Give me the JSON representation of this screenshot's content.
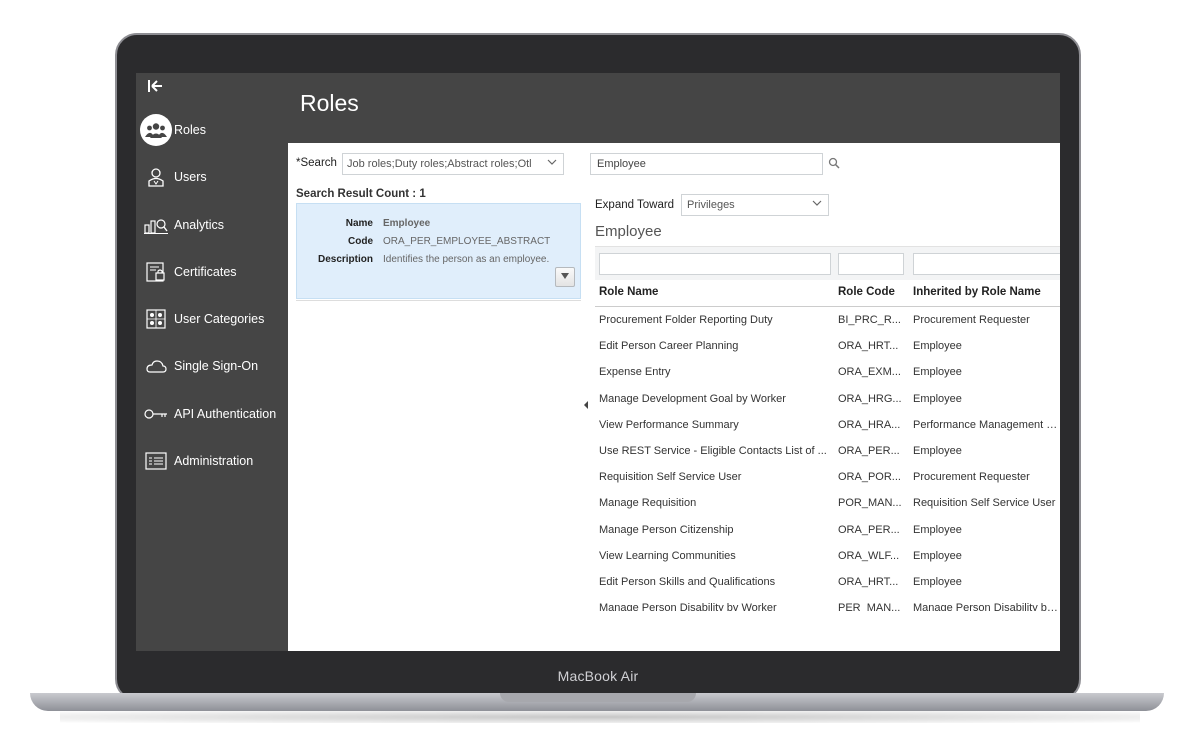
{
  "device": {
    "brand": "MacBook Air"
  },
  "sidebar": {
    "collapse_icon": "collapse-left-icon",
    "items": [
      {
        "label": "Roles",
        "icon": "roles-icon",
        "active": true
      },
      {
        "label": "Users",
        "icon": "user-icon"
      },
      {
        "label": "Analytics",
        "icon": "analytics-icon"
      },
      {
        "label": "Certificates",
        "icon": "certificate-icon"
      },
      {
        "label": "User Categories",
        "icon": "user-categories-icon"
      },
      {
        "label": "Single Sign-On",
        "icon": "cloud-icon"
      },
      {
        "label": "API Authentication",
        "icon": "key-icon"
      },
      {
        "label": "Administration",
        "icon": "list-icon"
      }
    ]
  },
  "header": {
    "title": "Roles"
  },
  "search": {
    "label": "Search",
    "required_mark": "*",
    "role_types_value": "Job roles;Duty roles;Abstract roles;Otl",
    "result_count_label": "Search Result Count : 1",
    "query_value": "Employee"
  },
  "result_card": {
    "name_label": "Name",
    "name_value": "Employee",
    "code_label": "Code",
    "code_value": "ORA_PER_EMPLOYEE_ABSTRACT",
    "description_label": "Description",
    "description_value": "Identifies the person as an employee."
  },
  "expand": {
    "label": "Expand Toward",
    "value": "Privileges"
  },
  "graph": {
    "title": "Employee"
  },
  "table": {
    "headers": {
      "role_name": "Role Name",
      "role_code": "Role Code",
      "inherited": "Inherited by Role Name"
    },
    "rows": [
      {
        "name": "Procurement Folder Reporting Duty",
        "code": "BI_PRC_R...",
        "inherited": "Procurement Requester"
      },
      {
        "name": "Edit Person Career Planning",
        "code": "ORA_HRT...",
        "inherited": "Employee"
      },
      {
        "name": "Expense Entry",
        "code": "ORA_EXM...",
        "inherited": "Employee"
      },
      {
        "name": "Manage Development Goal by Worker",
        "code": "ORA_HRG...",
        "inherited": "Employee"
      },
      {
        "name": "View Performance Summary",
        "code": "ORA_HRA...",
        "inherited": "Performance Management W..."
      },
      {
        "name": "Use REST Service - Eligible Contacts List of ...",
        "code": "ORA_PER...",
        "inherited": "Employee"
      },
      {
        "name": "Requisition Self Service User",
        "code": "ORA_POR...",
        "inherited": "Procurement Requester"
      },
      {
        "name": "Manage Requisition",
        "code": "POR_MAN...",
        "inherited": "Requisition Self Service User"
      },
      {
        "name": "Manage Person Citizenship",
        "code": "ORA_PER...",
        "inherited": "Employee"
      },
      {
        "name": "View Learning Communities",
        "code": "ORA_WLF...",
        "inherited": "Employee"
      },
      {
        "name": "Edit Person Skills and Qualifications",
        "code": "ORA_HRT...",
        "inherited": "Employee"
      },
      {
        "name": "Manage Person Disability by Worker",
        "code": "PER_MAN...",
        "inherited": "Manage Person Disability by ..."
      }
    ]
  },
  "colors": {
    "sidebar_bg": "#454545",
    "selection_bg": "#e0eefb",
    "text": "#333333"
  }
}
